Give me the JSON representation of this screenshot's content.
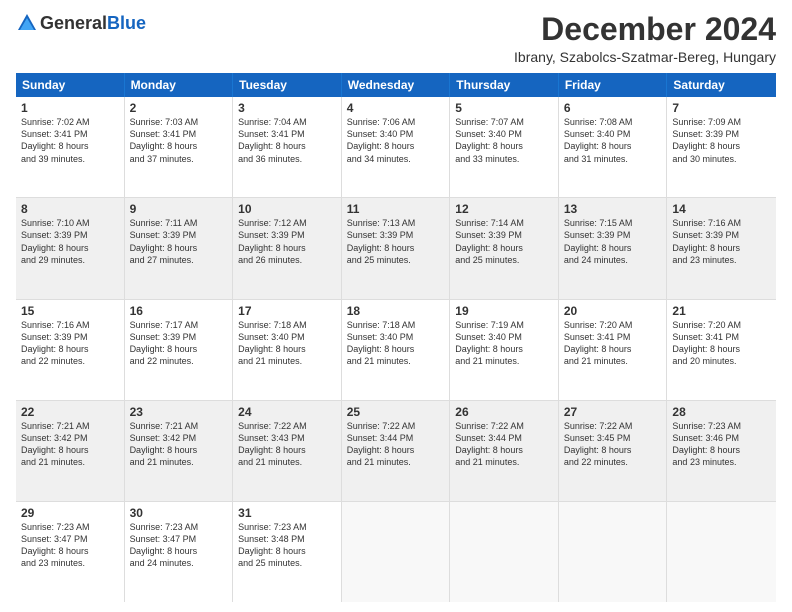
{
  "logo": {
    "general": "General",
    "blue": "Blue"
  },
  "title": "December 2024",
  "subtitle": "Ibrany, Szabolcs-Szatmar-Bereg, Hungary",
  "headers": [
    "Sunday",
    "Monday",
    "Tuesday",
    "Wednesday",
    "Thursday",
    "Friday",
    "Saturday"
  ],
  "rows": [
    [
      {
        "day": "1",
        "text": "Sunrise: 7:02 AM\nSunset: 3:41 PM\nDaylight: 8 hours\nand 39 minutes."
      },
      {
        "day": "2",
        "text": "Sunrise: 7:03 AM\nSunset: 3:41 PM\nDaylight: 8 hours\nand 37 minutes."
      },
      {
        "day": "3",
        "text": "Sunrise: 7:04 AM\nSunset: 3:41 PM\nDaylight: 8 hours\nand 36 minutes."
      },
      {
        "day": "4",
        "text": "Sunrise: 7:06 AM\nSunset: 3:40 PM\nDaylight: 8 hours\nand 34 minutes."
      },
      {
        "day": "5",
        "text": "Sunrise: 7:07 AM\nSunset: 3:40 PM\nDaylight: 8 hours\nand 33 minutes."
      },
      {
        "day": "6",
        "text": "Sunrise: 7:08 AM\nSunset: 3:40 PM\nDaylight: 8 hours\nand 31 minutes."
      },
      {
        "day": "7",
        "text": "Sunrise: 7:09 AM\nSunset: 3:39 PM\nDaylight: 8 hours\nand 30 minutes."
      }
    ],
    [
      {
        "day": "8",
        "text": "Sunrise: 7:10 AM\nSunset: 3:39 PM\nDaylight: 8 hours\nand 29 minutes."
      },
      {
        "day": "9",
        "text": "Sunrise: 7:11 AM\nSunset: 3:39 PM\nDaylight: 8 hours\nand 27 minutes."
      },
      {
        "day": "10",
        "text": "Sunrise: 7:12 AM\nSunset: 3:39 PM\nDaylight: 8 hours\nand 26 minutes."
      },
      {
        "day": "11",
        "text": "Sunrise: 7:13 AM\nSunset: 3:39 PM\nDaylight: 8 hours\nand 25 minutes."
      },
      {
        "day": "12",
        "text": "Sunrise: 7:14 AM\nSunset: 3:39 PM\nDaylight: 8 hours\nand 25 minutes."
      },
      {
        "day": "13",
        "text": "Sunrise: 7:15 AM\nSunset: 3:39 PM\nDaylight: 8 hours\nand 24 minutes."
      },
      {
        "day": "14",
        "text": "Sunrise: 7:16 AM\nSunset: 3:39 PM\nDaylight: 8 hours\nand 23 minutes."
      }
    ],
    [
      {
        "day": "15",
        "text": "Sunrise: 7:16 AM\nSunset: 3:39 PM\nDaylight: 8 hours\nand 22 minutes."
      },
      {
        "day": "16",
        "text": "Sunrise: 7:17 AM\nSunset: 3:39 PM\nDaylight: 8 hours\nand 22 minutes."
      },
      {
        "day": "17",
        "text": "Sunrise: 7:18 AM\nSunset: 3:40 PM\nDaylight: 8 hours\nand 21 minutes."
      },
      {
        "day": "18",
        "text": "Sunrise: 7:18 AM\nSunset: 3:40 PM\nDaylight: 8 hours\nand 21 minutes."
      },
      {
        "day": "19",
        "text": "Sunrise: 7:19 AM\nSunset: 3:40 PM\nDaylight: 8 hours\nand 21 minutes."
      },
      {
        "day": "20",
        "text": "Sunrise: 7:20 AM\nSunset: 3:41 PM\nDaylight: 8 hours\nand 21 minutes."
      },
      {
        "day": "21",
        "text": "Sunrise: 7:20 AM\nSunset: 3:41 PM\nDaylight: 8 hours\nand 20 minutes."
      }
    ],
    [
      {
        "day": "22",
        "text": "Sunrise: 7:21 AM\nSunset: 3:42 PM\nDaylight: 8 hours\nand 21 minutes."
      },
      {
        "day": "23",
        "text": "Sunrise: 7:21 AM\nSunset: 3:42 PM\nDaylight: 8 hours\nand 21 minutes."
      },
      {
        "day": "24",
        "text": "Sunrise: 7:22 AM\nSunset: 3:43 PM\nDaylight: 8 hours\nand 21 minutes."
      },
      {
        "day": "25",
        "text": "Sunrise: 7:22 AM\nSunset: 3:44 PM\nDaylight: 8 hours\nand 21 minutes."
      },
      {
        "day": "26",
        "text": "Sunrise: 7:22 AM\nSunset: 3:44 PM\nDaylight: 8 hours\nand 21 minutes."
      },
      {
        "day": "27",
        "text": "Sunrise: 7:22 AM\nSunset: 3:45 PM\nDaylight: 8 hours\nand 22 minutes."
      },
      {
        "day": "28",
        "text": "Sunrise: 7:23 AM\nSunset: 3:46 PM\nDaylight: 8 hours\nand 23 minutes."
      }
    ],
    [
      {
        "day": "29",
        "text": "Sunrise: 7:23 AM\nSunset: 3:47 PM\nDaylight: 8 hours\nand 23 minutes."
      },
      {
        "day": "30",
        "text": "Sunrise: 7:23 AM\nSunset: 3:47 PM\nDaylight: 8 hours\nand 24 minutes."
      },
      {
        "day": "31",
        "text": "Sunrise: 7:23 AM\nSunset: 3:48 PM\nDaylight: 8 hours\nand 25 minutes."
      },
      {
        "day": "",
        "text": ""
      },
      {
        "day": "",
        "text": ""
      },
      {
        "day": "",
        "text": ""
      },
      {
        "day": "",
        "text": ""
      }
    ]
  ]
}
